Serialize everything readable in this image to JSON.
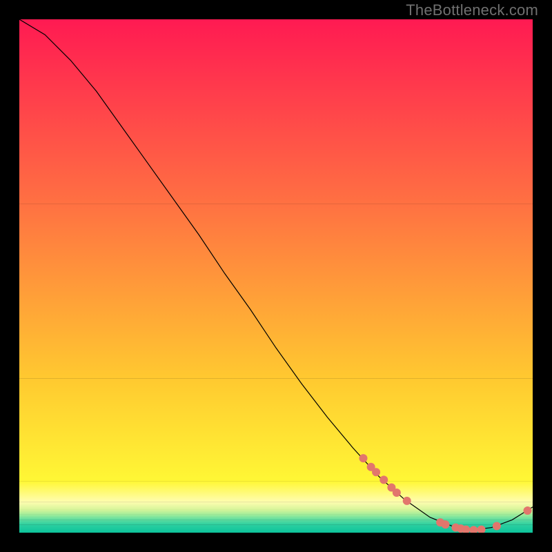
{
  "watermark": "TheBottleneck.com",
  "chart_data": {
    "type": "line",
    "title": "",
    "xlabel": "",
    "ylabel": "",
    "xlim": [
      0,
      100
    ],
    "ylim": [
      0,
      100
    ],
    "series": [
      {
        "name": "curve",
        "color": "#000000",
        "stroke_width": 1.2,
        "points": [
          {
            "x": 0,
            "y": 100
          },
          {
            "x": 5,
            "y": 97
          },
          {
            "x": 10,
            "y": 92
          },
          {
            "x": 15,
            "y": 86
          },
          {
            "x": 20,
            "y": 79
          },
          {
            "x": 25,
            "y": 72
          },
          {
            "x": 30,
            "y": 65
          },
          {
            "x": 35,
            "y": 58
          },
          {
            "x": 40,
            "y": 50.5
          },
          {
            "x": 45,
            "y": 43.5
          },
          {
            "x": 50,
            "y": 36
          },
          {
            "x": 55,
            "y": 29
          },
          {
            "x": 60,
            "y": 22.5
          },
          {
            "x": 65,
            "y": 16.5
          },
          {
            "x": 70,
            "y": 11
          },
          {
            "x": 75,
            "y": 6.5
          },
          {
            "x": 80,
            "y": 3.0
          },
          {
            "x": 85,
            "y": 1.0
          },
          {
            "x": 88,
            "y": 0.5
          },
          {
            "x": 92,
            "y": 1.0
          },
          {
            "x": 96,
            "y": 2.5
          },
          {
            "x": 100,
            "y": 5.0
          }
        ]
      }
    ],
    "markers": {
      "color": "#e2766c",
      "radius": 6,
      "points": [
        {
          "x": 67,
          "y": 14.5
        },
        {
          "x": 68.5,
          "y": 12.8
        },
        {
          "x": 69.5,
          "y": 11.8
        },
        {
          "x": 71,
          "y": 10.3
        },
        {
          "x": 72.5,
          "y": 8.8
        },
        {
          "x": 73.5,
          "y": 7.8
        },
        {
          "x": 75.5,
          "y": 6.2
        },
        {
          "x": 82,
          "y": 2.0
        },
        {
          "x": 83,
          "y": 1.6
        },
        {
          "x": 85,
          "y": 1.0
        },
        {
          "x": 86,
          "y": 0.8
        },
        {
          "x": 87,
          "y": 0.6
        },
        {
          "x": 88.5,
          "y": 0.5
        },
        {
          "x": 90,
          "y": 0.6
        },
        {
          "x": 93,
          "y": 1.3
        },
        {
          "x": 99,
          "y": 4.3
        }
      ]
    },
    "gradient_bands": [
      {
        "y0": 100,
        "y1": 64,
        "c0": "#ff1a52",
        "c1": "#ff7142"
      },
      {
        "y0": 64,
        "y1": 30,
        "c0": "#ff7142",
        "c1": "#ffc930"
      },
      {
        "y0": 30,
        "y1": 10,
        "c0": "#ffc930",
        "c1": "#fff735"
      },
      {
        "y0": 10,
        "y1": 6,
        "c0": "#fff735",
        "c1": "#fffdb0"
      },
      {
        "y0": 6,
        "y1": 4.5,
        "c0": "#fffdb0",
        "c1": "#d6f59a"
      },
      {
        "y0": 4.5,
        "y1": 3.5,
        "c0": "#d6f59a",
        "c1": "#9fec9a"
      },
      {
        "y0": 3.5,
        "y1": 2.5,
        "c0": "#9fec9a",
        "c1": "#5cdca0"
      },
      {
        "y0": 2.5,
        "y1": 1.5,
        "c0": "#5cdca0",
        "c1": "#2bcfa0"
      },
      {
        "y0": 1.5,
        "y1": 0,
        "c0": "#2bcfa0",
        "c1": "#0cc49b"
      }
    ]
  }
}
